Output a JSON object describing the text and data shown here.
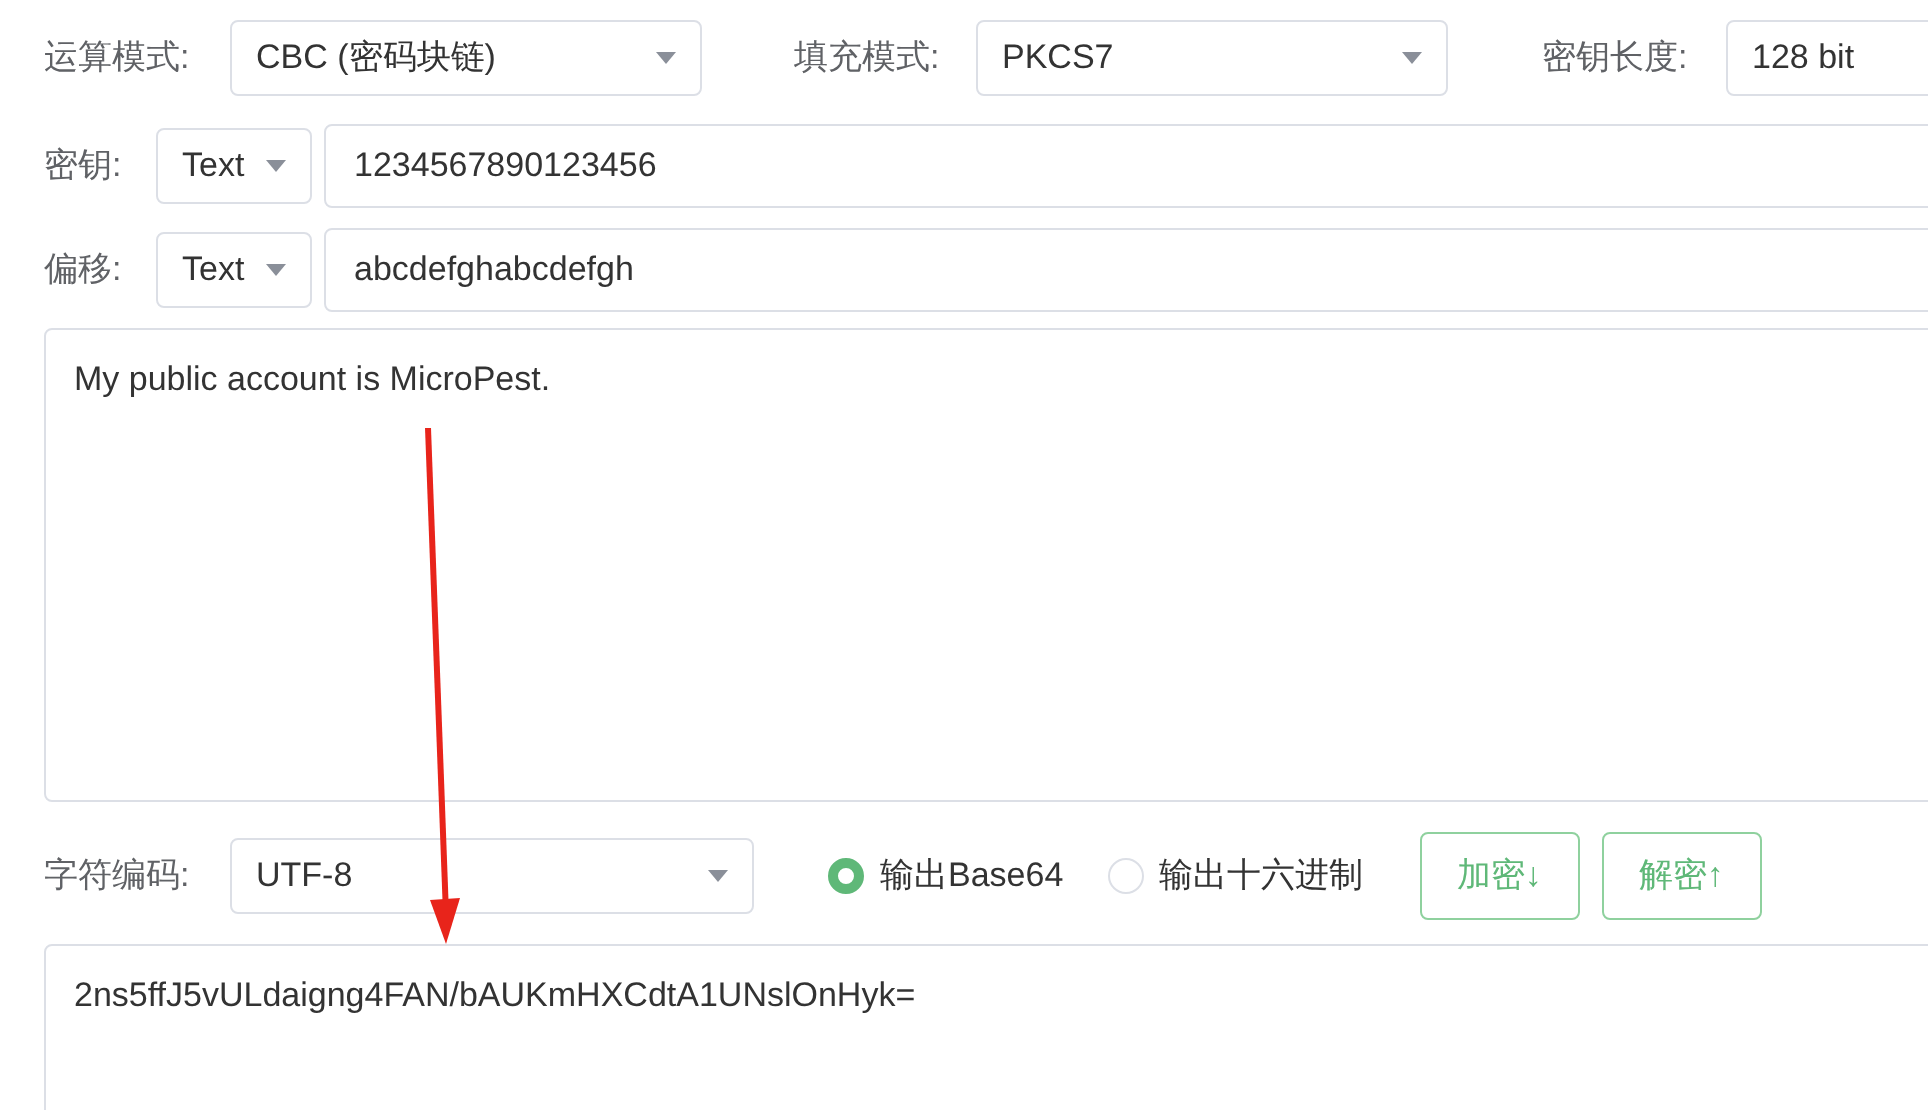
{
  "mode": {
    "label": "运算模式:",
    "value": "CBC (密码块链)"
  },
  "padding": {
    "label": "填充模式:",
    "value": "PKCS7"
  },
  "key_length": {
    "label": "密钥长度:",
    "value": "128 bit"
  },
  "key": {
    "label": "密钥:",
    "format": "Text",
    "value": "1234567890123456"
  },
  "iv": {
    "label": "偏移:",
    "format": "Text",
    "value": "abcdefghabcdefgh"
  },
  "input_text": "My public account is MicroPest.",
  "encoding": {
    "label": "字符编码:",
    "value": "UTF-8"
  },
  "output_formats": [
    {
      "label": "输出Base64",
      "selected": true
    },
    {
      "label": "输出十六进制",
      "selected": false
    }
  ],
  "buttons": [
    "加密↓",
    "解密↑"
  ],
  "output_text": "2ns5ffJ5vULdaigng4FAN/bAUKmHXCdtA1UNslOnHyk="
}
